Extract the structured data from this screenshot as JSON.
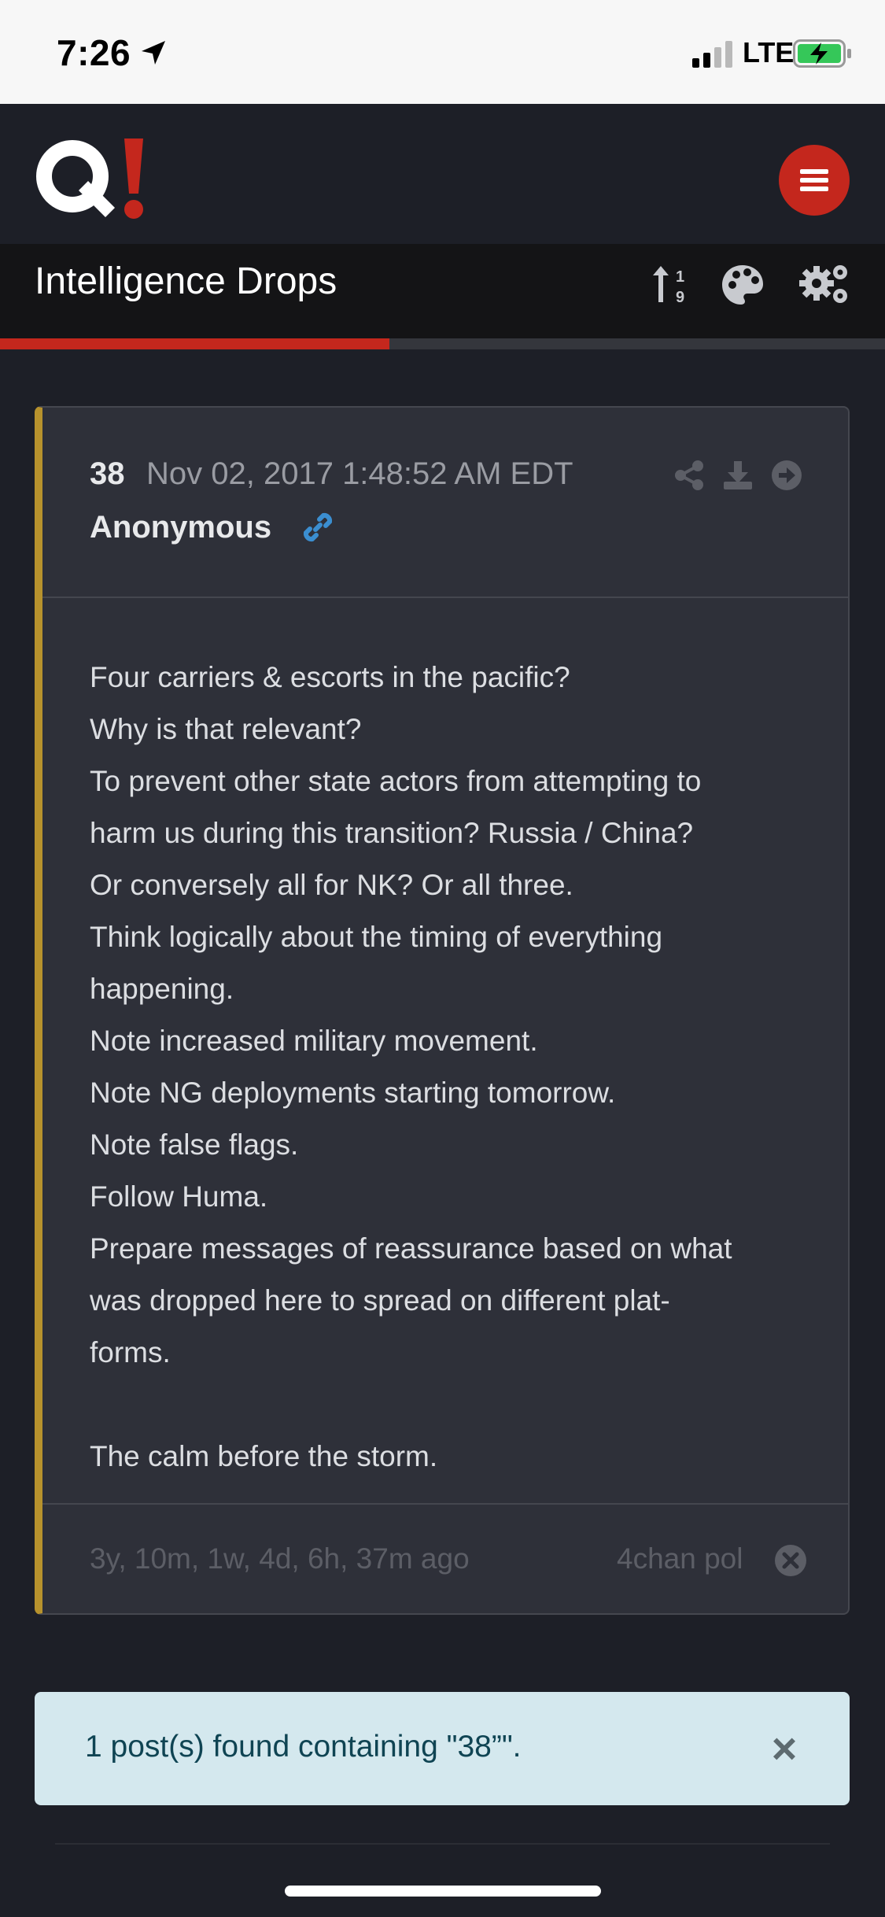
{
  "status_bar": {
    "time": "7:26",
    "network": "LTE",
    "icons": [
      "location-arrow-icon",
      "signal-icon",
      "battery-charging-icon"
    ]
  },
  "header": {
    "logo_text": "Q!",
    "menu_icon": "hamburger-menu-icon"
  },
  "title_bar": {
    "title": "Intelligence Drops",
    "icons": [
      "sort-numeric-icon",
      "palette-icon",
      "settings-gears-icon"
    ],
    "progress": 0.44
  },
  "post": {
    "number": "38",
    "date": "Nov 02, 2017 1:48:52 AM EDT",
    "author": "Anonymous",
    "header_icons": [
      "share-icon",
      "download-icon",
      "arrow-right-circle-icon"
    ],
    "body_lines": [
      "Four carriers & escorts in the pacific?",
      "Why is that relevant?",
      "To prevent other state actors from attempting to",
      "harm us during this transition? Russia / China?",
      "Or conversely all for NK? Or all three.",
      "Think logically about the timing of everything",
      "happening.",
      "Note increased military movement.",
      "Note NG deployments starting tomorrow.",
      "Note false flags.",
      "Follow Huma.",
      "Prepare messages of reassurance based on what",
      "was dropped here to spread on different plat-",
      "forms.",
      "",
      "The calm before the storm."
    ],
    "ago": "3y, 10m, 1w, 4d, 6h, 37m ago",
    "source": "4chan pol"
  },
  "alert": {
    "text": "1 post(s) found containing \"38”\".",
    "close": "×"
  },
  "colors": {
    "accent_red": "#c4271d",
    "post_border_gold": "#b7922d",
    "link_blue": "#3b8ed0",
    "alert_bg": "#d4e8ee"
  }
}
